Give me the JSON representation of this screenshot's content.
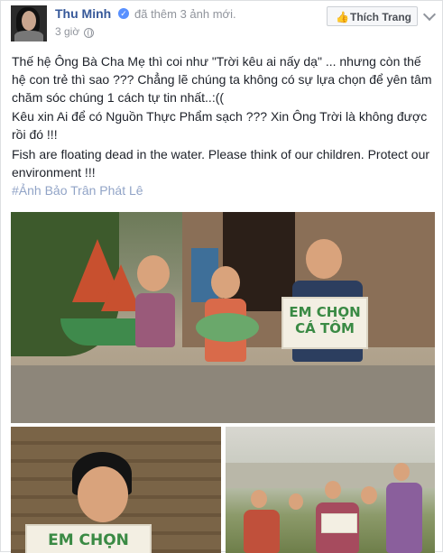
{
  "header": {
    "author": "Thu Minh",
    "action": "đã thêm 3 ảnh mới.",
    "time": "3 giờ",
    "like_button": "Thích Trang",
    "like_icon": "thumbs-up-icon",
    "verified_icon": "verified-check-icon"
  },
  "post": {
    "paragraphs": [
      "Thế hệ Ông Bà Cha Mẹ thì coi như \"Trời kêu ai nấy dạ\" ... nhưng còn thế hệ con trẻ thì sao ??? Chẳng lẽ chúng ta không có sự lựa chọn để yên tâm chăm sóc chúng 1 cách tự tin nhất..:((",
      "Kêu xin Ai để có Nguồn Thực Phẩm sạch ??? Xin Ông Trời là không được rồi đó !!!",
      "Fish are floating dead in the water. Please think of our children. Protect our environment !!!"
    ],
    "hashtag": "#Ảnh Bảo Trân Phát Lê"
  },
  "photos": {
    "main_sign": {
      "line1": "EM CHỌN",
      "line2": "CÁ TÔM"
    },
    "bottom_left_sign": {
      "line1": "EM CHỌN"
    }
  },
  "colors": {
    "link": "#365899",
    "muted": "#90949c",
    "verified": "#5890ff"
  }
}
